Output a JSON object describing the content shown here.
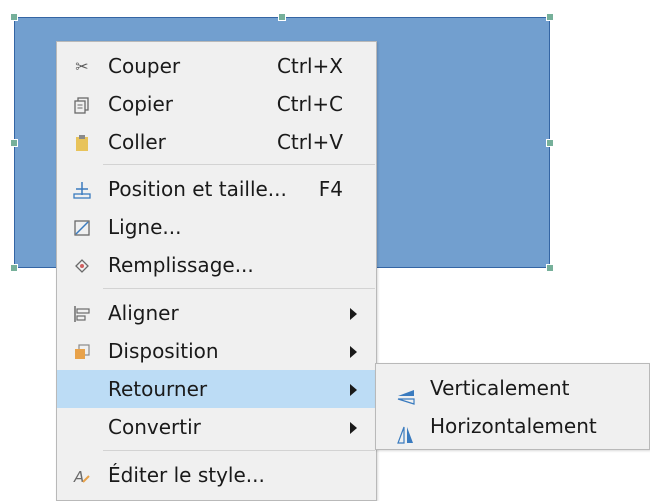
{
  "colors": {
    "shape_fill": "#729fcf",
    "shape_border": "#3465a4",
    "handle": "#76b09a",
    "menu_bg": "#f0f0f0",
    "highlight": "#bcdcf5"
  },
  "context_menu": {
    "items": [
      {
        "label": "Couper",
        "shortcut": "Ctrl+X",
        "icon": "scissors-icon"
      },
      {
        "label": "Copier",
        "shortcut": "Ctrl+C",
        "icon": "copy-icon"
      },
      {
        "label": "Coller",
        "shortcut": "Ctrl+V",
        "icon": "paste-icon"
      },
      {
        "label": "Position et taille...",
        "shortcut": "F4",
        "icon": "position-size-icon"
      },
      {
        "label": "Ligne...",
        "shortcut": "",
        "icon": "line-icon"
      },
      {
        "label": "Remplissage...",
        "shortcut": "",
        "icon": "fill-icon"
      },
      {
        "label": "Aligner",
        "shortcut": "",
        "icon": "align-icon",
        "submenu": true
      },
      {
        "label": "Disposition",
        "shortcut": "",
        "icon": "arrange-icon",
        "submenu": true
      },
      {
        "label": "Retourner",
        "shortcut": "",
        "icon": "",
        "submenu": true,
        "highlighted": true
      },
      {
        "label": "Convertir",
        "shortcut": "",
        "icon": "",
        "submenu": true
      },
      {
        "label": "Éditer le style...",
        "shortcut": "",
        "icon": "edit-style-icon"
      }
    ]
  },
  "flip_submenu": {
    "items": [
      {
        "label": "Verticalement",
        "icon": "flip-vertical-icon"
      },
      {
        "label": "Horizontalement",
        "icon": "flip-horizontal-icon"
      }
    ]
  }
}
